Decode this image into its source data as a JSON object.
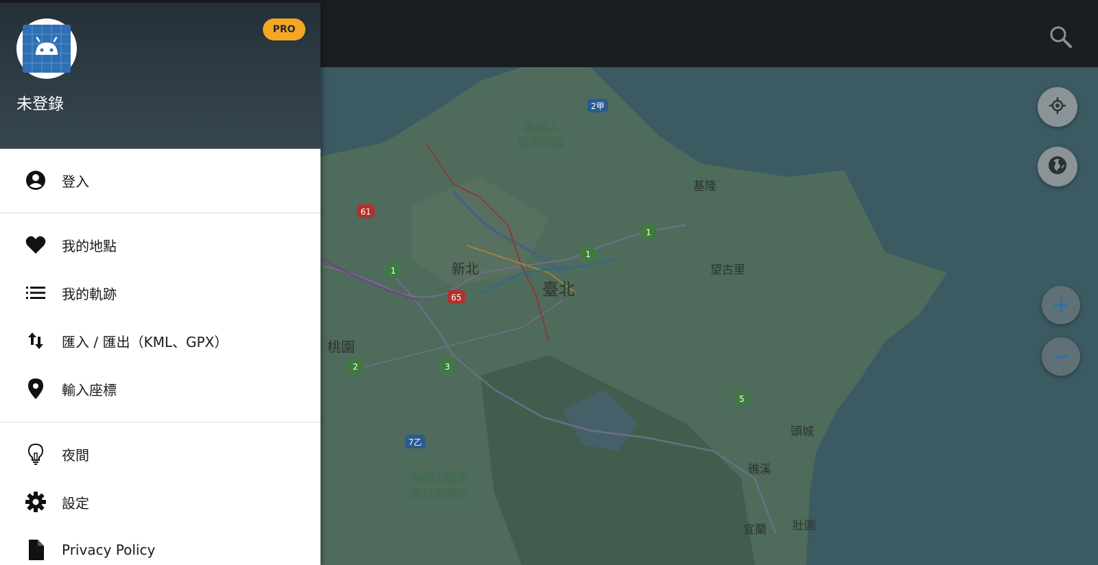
{
  "appbar": {
    "search_icon": "search-icon"
  },
  "drawer": {
    "pro_badge": "PRO",
    "username": "未登錄",
    "avatar_icon": "android-icon",
    "items": [
      {
        "label": "登入",
        "icon": "account-circle-icon"
      },
      {
        "label": "我的地點",
        "icon": "heart-icon"
      },
      {
        "label": "我的軌跡",
        "icon": "list-icon"
      },
      {
        "label": "匯入 / 匯出（KML、GPX）",
        "icon": "import-export-icon"
      },
      {
        "label": "輸入座標",
        "icon": "location-pin-icon"
      },
      {
        "label": "夜間",
        "icon": "lightbulb-icon"
      },
      {
        "label": "設定",
        "icon": "gear-icon"
      },
      {
        "label": "Privacy Policy",
        "icon": "document-icon"
      }
    ]
  },
  "map": {
    "labels": {
      "yangmingshan": "陽明山\n國家公園",
      "keelung": "基隆",
      "xinbei": "新北",
      "taipei": "臺北",
      "wangguli": "望古里",
      "taoyuan": "桃園",
      "toucheng": "頭城",
      "jiaoxi": "礁溪",
      "yilan": "宜蘭",
      "zhuangwei": "壯圍",
      "dongyanshan": "東眼山國家\n森林遊樂區"
    },
    "shields": [
      "2甲",
      "61",
      "1",
      "1",
      "1",
      "65",
      "2",
      "3",
      "5",
      "7乙"
    ]
  },
  "controls": {
    "locate_icon": "my-location-icon",
    "layers_icon": "globe-icon",
    "zoom_in": "+",
    "zoom_out": "−"
  }
}
